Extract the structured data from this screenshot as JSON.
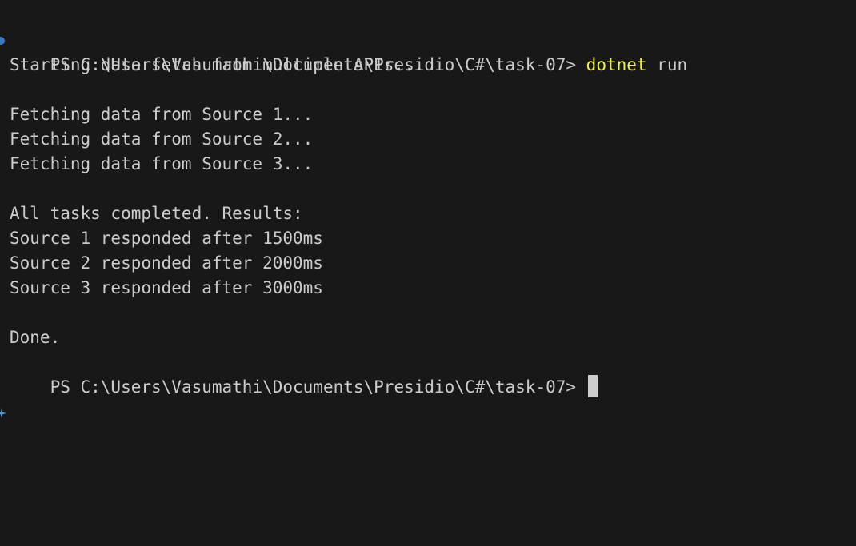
{
  "terminal": {
    "first_prompt": {
      "path": "PS C:\\Users\\Vasumathi\\Documents\\Presidio\\C#\\task-07> ",
      "command": "dotnet",
      "argument": " run"
    },
    "output": {
      "starting": "Starting data fetch from multiple APIs...",
      "fetch_1": "Fetching data from Source 1...",
      "fetch_2": "Fetching data from Source 2...",
      "fetch_3": "Fetching data from Source 3...",
      "completed": "All tasks completed. Results:",
      "result_1": "Source 1 responded after 1500ms",
      "result_2": "Source 2 responded after 2000ms",
      "result_3": "Source 3 responded after 3000ms",
      "done": "Done."
    },
    "second_prompt": {
      "path": "PS C:\\Users\\Vasumathi\\Documents\\Presidio\\C#\\task-07> "
    }
  },
  "colors": {
    "background": "#181818",
    "text": "#cccccc",
    "command": "#f1f14c",
    "success_decoration": "#3a79c2"
  },
  "icons": {
    "success_decoration": "command-success-dot-icon",
    "empty_decoration": "command-decoration-sparkle-icon"
  }
}
